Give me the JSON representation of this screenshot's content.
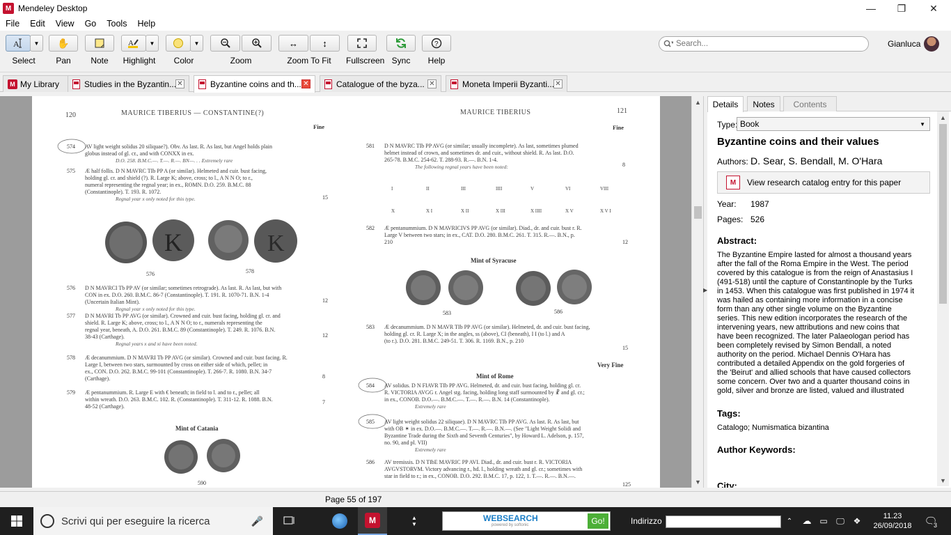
{
  "window": {
    "title": "Mendeley Desktop",
    "minimize": "—",
    "maximize": "❐",
    "close": "✕"
  },
  "menu": [
    "File",
    "Edit",
    "View",
    "Go",
    "Tools",
    "Help"
  ],
  "toolbar": {
    "select": "Select",
    "pan": "Pan",
    "note": "Note",
    "highlight": "Highlight",
    "color": "Color",
    "zoom": "Zoom",
    "zoom_to_fit": "Zoom To Fit",
    "fullscreen": "Fullscreen",
    "sync": "Sync",
    "help": "Help",
    "highlight_color": "#f9e27a"
  },
  "search": {
    "placeholder": "Search..."
  },
  "user": {
    "name": "Gianluca"
  },
  "tabs": [
    {
      "label": "My Library"
    },
    {
      "label": "Studies in the Byzantin..."
    },
    {
      "label": "Byzantine coins and th..."
    },
    {
      "label": "Catalogue of the byza..."
    },
    {
      "label": "Moneta Imperii Byzanti..."
    }
  ],
  "pdf": {
    "left_page_number": "120",
    "left_header": "MAURICE TIBERIUS — CONSTANTINE(?)",
    "right_header": "MAURICE TIBERIUS",
    "right_page_number": "121",
    "fine_label": "Fine",
    "very_fine_label": "Very Fine",
    "left_entries": [
      {
        "num": "574",
        "head": "AV light weight solidus",
        "body": "20 siliquae?). Obv. As last. R. As last, but Angel holds plain globus instead of gl. cr., and with CONXX in ex.",
        "ref": "D.O. 258. B.M.C.—. T.—. R.—. BN—. . . Extremely rare"
      },
      {
        "num": "575",
        "head": "Æ half follis.",
        "body": "D N MAVRC TIb PP A (or similar). Helmeted and cuir. bust facing, holding gl. cr. and shield (?). R. Large K; above, cross; to l., A N N O; to r., numeral representing the regnal year; in ex., ROMN. D.O. 259. B.M.C. 88 (Constantinople). T. 193. R. 1072.",
        "ref": "Regnal year x only noted for this type."
      },
      {
        "num": "576",
        "head": "",
        "body": "D N MAVRCI Tb PP AV (or similar; sometimes retrograde). As last. R. As last, but with CON in ex. D.O. 260. B.M.C. 86-7 (Constantinople). T. 191. R. 1070-71. B.N. 1-4 (Uncertain Italian Mint).",
        "ref": "Regnal year x only noted for this type."
      },
      {
        "num": "577",
        "head": "",
        "body": "D N MAVRI Tb PP AVG (or similar). Crowned and cuir. bust facing, holding gl. cr. and shield. R. Large K; above, cross; to l., A N N O; to r., numerals representing the regnal year, beneath, A. D.O. 261. B.M.C. 89 (Constantinople). T. 249. R. 1076. B.N. 38-43 (Carthage).",
        "ref": "Regnal years x and xi have been noted."
      },
      {
        "num": "578",
        "head": "Æ decanummium.",
        "body": "D N MAVRI Tb PP AVG (or similar). Crowned and cuir. bust facing. R. Large I, between two stars, surmounted by cross on either side of which, pellet; in ex., CON. D.O. 262. B.M.C. 99-101 (Constantinople). T. 266-7. R. 1080. B.N. 34-7 (Carthage).",
        "ref": ""
      },
      {
        "num": "579",
        "head": "Æ pentanummium.",
        "body": "R. Large E with € beneath; in field to l. and to r., pellet; all within wreath. D.O. 263. B.M.C. 102. R. (Constantinople). T. 311-12. R. 1088. B.N. 48-52 (Carthage).",
        "ref": ""
      }
    ],
    "left_mint": "Mint of Catania",
    "left_coin_captions": [
      "576",
      "578"
    ],
    "left_bottom_caption": "590",
    "right_entries": [
      {
        "num": "581",
        "head": "",
        "body": "D N MAVRC TIb PP AVG (or similar; usually incomplete). As last, sometimes plumed helmet instead of crown, and sometimes dr. and cuir., without shield. R. As last. D.O. 265-78. B.M.C. 254-62. T. 288-93. R.—. B.N. 1-4.",
        "ref": "The following regnal years have been noted:"
      },
      {
        "num": "582",
        "head": "Æ pentanummium.",
        "body": "D N MAVRICIVS PP AVG (or similar). Diad., dr. and cuir. bust r. R. Large V between two stars; in ex., CAT. D.O. 280. B.M.C. 261. T. 315. R.—. B.N., p. 210",
        "ref": ""
      },
      {
        "num": "583",
        "head": "Æ decanummium.",
        "body": "D N MAVR TIb PP AVG (or similar). Helmeted, dr. and cuir. bust facing, holding gl. cr. R. Large X; in the angles, ss (above), CI (beneath), I I (to l.) and A (to r.). D.O. 281. B.M.C. 249-51. T. 306. R. 1169. B.N., p. 210",
        "ref": ""
      },
      {
        "num": "584",
        "head": "AV solidus.",
        "body": "D N FIAVR TIb PP AVG. Helmeted, dr. and cuir. bust facing, holding gl. cr. R. VICTORIA AVGG r. Angel stg. facing, holding long staff surmounted by ☧ and gl. cr.; in ex., CONOB. D.O.—. B.M.C.—. T.—. R.—. B.N. 14 (Constantinople).",
        "ref": "Extremely rare"
      },
      {
        "num": "585",
        "head": "AV light weight solidus",
        "body": "22 siliquae). D N MAVRC TIb PP AVG. As last. R. As last, but with OB ✶ in ex. D.O.—. B.M.C.—. T.—. R.—. B.N.—. (See \"Light Weight Solidi and Byzantine Trade during the Sixth and Seventh Centuries\", by Howard L. Adelson, p. 157, no. 90, and pl. VII)",
        "ref": "Extremely rare"
      },
      {
        "num": "586",
        "head": "AV tremissis.",
        "body": "D N TIbE MAVRIC PP AVI. Diad., dr. and cuir. bust r. R. VICTORIA AVGVSTORVM. Victory advancing r., hd. l., holding wreath and gl. cr.; sometimes with star in field to r.; in ex., CONOB. D.O. 292. B.M.C. 17, p. 122, 1. T.—. R.—. B.N.—.",
        "ref": ""
      }
    ],
    "regnal_row1": [
      "I",
      "II",
      "III",
      "IIII",
      "V",
      "VI",
      "VIII"
    ],
    "regnal_row2": [
      "X",
      "X I",
      "X II",
      "X III",
      "X IIII",
      "X V",
      "X V I"
    ],
    "right_mint_syracuse": "Mint of Syracuse",
    "right_coin_captions": [
      "583",
      "586"
    ],
    "right_mint_rome": "Mint of Rome",
    "right_prices": [
      "8",
      "12",
      "15",
      "125"
    ],
    "left_prices": [
      "15",
      "12",
      "12",
      "8",
      "7"
    ]
  },
  "status": {
    "page": "Page 55 of 197"
  },
  "details": {
    "tabs": [
      "Details",
      "Notes",
      "Contents"
    ],
    "type_label": "Type:",
    "type_value": "Book",
    "title": "Byzantine coins and their values",
    "authors_label": "Authors:",
    "authors": "D. Sear, S. Bendall, M. O'Hara",
    "catalog_button": "View research catalog entry for this paper",
    "year_label": "Year:",
    "year": "1987",
    "pages_label": "Pages:",
    "pages": "526",
    "abstract_label": "Abstract:",
    "abstract": "The Byzantine Empire lasted for almost a thousand years after the fall of the Roma Empire in the West. The period covered by this catalogue is from the reign of Anastasius I (491-518) until the capture of Constantinople by the Turks in 1453. When this catalogue was first published in 1974 it was hailed as containing more information in a concise form than any other single volume on the Byzantine series. This new edition incorporates the research of the intervening years, new attributions and new coins that have been recognized. The later Palaeologan period has been completely revised by Simon Bendall, a noted authority on the period. Michael Dennis O'Hara has contributed a detailed Appendix on the gold forgeries of the 'Beirut' and allied schools that have caused collectors some concern. Over two and a quarter thousand coins in gold, silver and bronze are listed, valued and illustrated with more than ...",
    "tags_label": "Tags:",
    "tags": "Catalogo; Numismatica bizantina",
    "keywords_label": "Author Keywords:",
    "city_label": "City:"
  },
  "taskbar": {
    "search_placeholder": "Scrivi qui per eseguire la ricerca",
    "websearch": "WEBSEARCH",
    "websearch_sub": "powered by softonic",
    "go": "Go!",
    "address_label": "Indirizzo",
    "time": "11.23",
    "date": "26/09/2018",
    "notifications": "3"
  }
}
